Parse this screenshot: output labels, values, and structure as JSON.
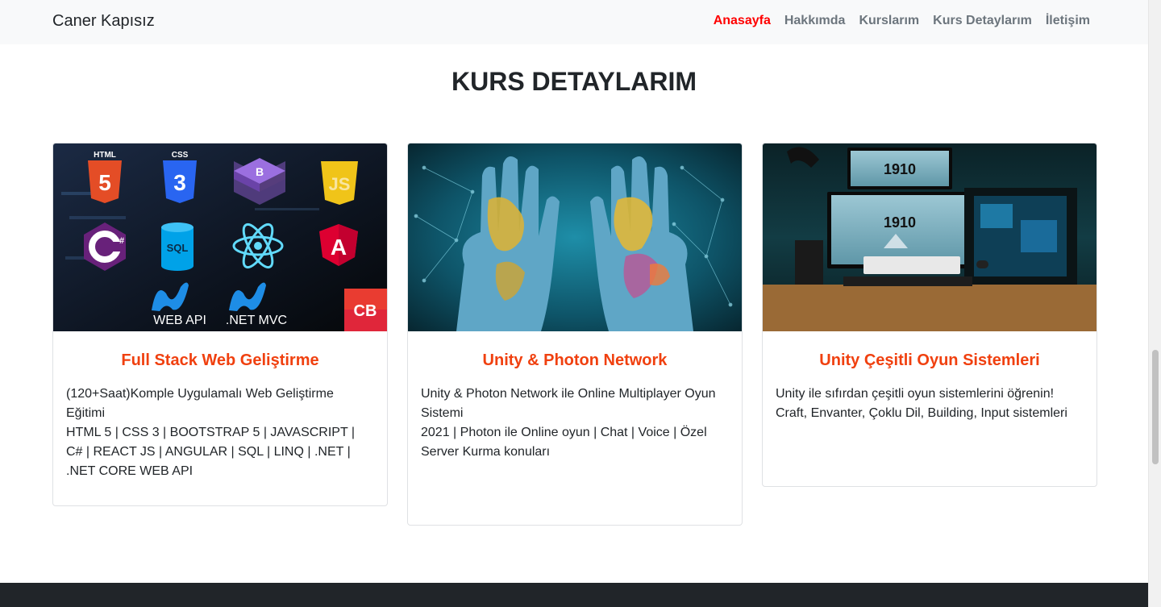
{
  "nav": {
    "brand": "Caner Kapısız",
    "links": [
      "Anasayfa",
      "Hakkımda",
      "Kurslarım",
      "Kurs Detaylarım",
      "İletişim"
    ]
  },
  "section": {
    "title": "KURS DETAYLARIM"
  },
  "cards": [
    {
      "title": "Full Stack Web Geliştirme",
      "text": "(120+Saat)Komple Uygulamalı Web Geliştirme Eğitimi\nHTML 5 | CSS 3 | BOOTSTRAP 5 | JAVASCRIPT | C# | REACT JS | ANGULAR | SQL | LINQ | .NET | .NET CORE WEB API",
      "image": {
        "labels": [
          "HTML",
          "CSS",
          "SQL",
          "WEB API",
          ".NET MVC",
          "CB"
        ]
      }
    },
    {
      "title": "Unity & Photon Network",
      "text": "Unity & Photon Network ile Online Multiplayer Oyun Sistemi\n2021 | Photon ile Online oyun | Chat | Voice | Özel Server Kurma konuları"
    },
    {
      "title": "Unity Çeşitli Oyun Sistemleri",
      "text": "Unity ile sıfırdan çeşitli oyun sistemlerini öğrenin!\nCraft, Envanter, Çoklu Dil, Building, Input sistemleri",
      "image": {
        "labels": [
          "1910",
          "1910"
        ]
      }
    }
  ],
  "colors": {
    "active_link": "#ff0000",
    "card_title": "#f0400f",
    "navbar_bg": "#f8f9fa",
    "footer_bg": "#212529"
  }
}
